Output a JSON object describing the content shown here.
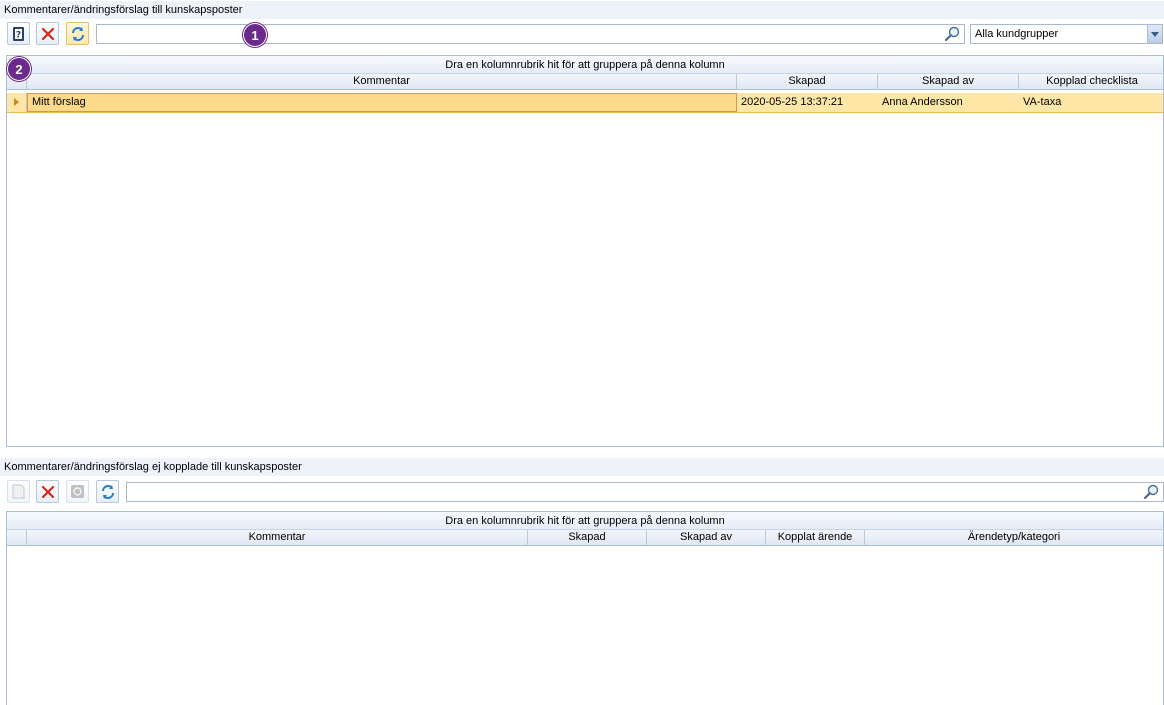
{
  "top_section": {
    "title": "Kommentarer/ändringsförslag till kunskapsposter",
    "search": {
      "value": "",
      "placeholder": ""
    },
    "customer_group": {
      "selected": "Alla kundgrupper"
    },
    "grid": {
      "group_panel_text": "Dra en kolumnrubrik hit för att gruppera på denna kolumn",
      "columns": [
        "Kommentar",
        "Skapad",
        "Skapad av",
        "Kopplad checklista"
      ],
      "rows": [
        {
          "kommentar": "Mitt förslag",
          "skapad": "2020-05-25 13:37:21",
          "skapad_av": "Anna Andersson",
          "kopplad_checklista": "VA-taxa"
        }
      ]
    }
  },
  "bottom_section": {
    "title": "Kommentarer/ändringsförslag ej kopplade till kunskapsposter",
    "search": {
      "value": "",
      "placeholder": ""
    },
    "grid": {
      "group_panel_text": "Dra en kolumnrubrik hit för att gruppera på denna kolumn",
      "columns": [
        "Kommentar",
        "Skapad",
        "Skapad av",
        "Kopplat ärende",
        "Ärendetyp/kategori"
      ]
    }
  },
  "badges": {
    "one": "1",
    "two": "2"
  },
  "icons": {
    "help": "help-book-icon",
    "delete": "red-x-icon",
    "refresh": "refresh-arrows-icon",
    "search": "magnifier-icon",
    "new": "document-icon",
    "link": "link-icon"
  },
  "colors": {
    "selected_row": "#fde6a6",
    "selected_border": "#e8913a",
    "badge": "#6a2b8c",
    "header": "#dfe8f4"
  }
}
